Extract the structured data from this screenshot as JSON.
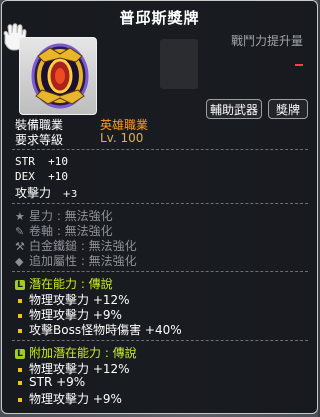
{
  "item": {
    "name": "普邱斯獎牌",
    "damage_label": "戰鬥力提升量",
    "buttons": [
      "輔助武器",
      "獎牌"
    ],
    "job_label": "裝備職業",
    "job_value": "英雄職業",
    "level_label": "要求等級",
    "level_value": "Lv. 100",
    "stats": [
      {
        "name": "STR",
        "value": "+10"
      },
      {
        "name": "DEX",
        "value": "+10"
      },
      {
        "name": "攻擊力",
        "value": "+3"
      }
    ],
    "upgrades": [
      {
        "icon": "star-icon",
        "label": "星力 : 無法強化"
      },
      {
        "icon": "scroll-icon",
        "label": "卷軸 : 無法強化"
      },
      {
        "icon": "hammer-icon",
        "label": "白金鐵鎚 : 無法強化"
      },
      {
        "icon": "flame-icon",
        "label": "追加屬性 : 無法強化"
      }
    ],
    "potential": {
      "title": "潛在能力 : 傳說",
      "lines": [
        "物理攻擊力 +12%",
        "物理攻擊力 +9%",
        "攻擊Boss怪物時傷害 +40%"
      ]
    },
    "bonus_potential": {
      "title": "附加潛在能力 : 傳說",
      "lines": [
        "物理攻擊力 +12%",
        "STR +9%",
        "物理攻擊力 +9%"
      ]
    },
    "colors": {
      "legendary": "#9ecf1c",
      "job": "#ff9c1c",
      "level": "#d9b25a",
      "damage": "#ff3c4a"
    }
  }
}
